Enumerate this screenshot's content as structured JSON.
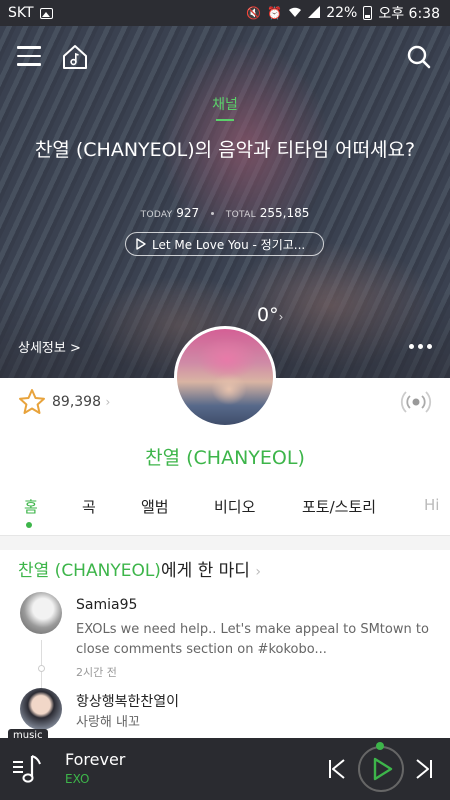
{
  "status_bar": {
    "carrier": "SKT",
    "battery": "22%",
    "time": "오후 6:38"
  },
  "hero": {
    "channel_label": "채널",
    "title": "찬열 (CHANYEOL)의 음악과 티타임 어떠세요?",
    "today_label": "TODAY",
    "today_value": "927",
    "total_label": "TOTAL",
    "total_value": "255,185",
    "song_pill": "Let Me Love You - 정기고...",
    "temperature": "0°",
    "details_link": "상세정보 >"
  },
  "profile": {
    "favorites": "89,398",
    "artist_name": "찬열 (CHANYEOL)"
  },
  "tabs": [
    {
      "label": "홈",
      "active": true
    },
    {
      "label": "곡",
      "active": false
    },
    {
      "label": "앨범",
      "active": false
    },
    {
      "label": "비디오",
      "active": false
    },
    {
      "label": "포토/스토리",
      "active": false
    },
    {
      "label": "Hi",
      "active": false
    }
  ],
  "comments_section": {
    "title_artist": "찬열 (CHANYEOL)",
    "title_rest": "에게 한 마디",
    "comments": [
      {
        "user": "Samia95",
        "text": "EXOLs we need help.. Let's make appeal to SMtown to close comments section on #kokobo...",
        "time": "2시간 전"
      },
      {
        "user": "항상행복한찬열이",
        "text": "사랑해 내꼬"
      }
    ]
  },
  "player": {
    "badge": "music",
    "track_title": "Forever",
    "track_artist": "EXO"
  },
  "colors": {
    "accent_green": "#3db54a",
    "hero_green": "#5bd06a",
    "player_bg": "#2a2b30"
  },
  "icons": [
    "menu-icon",
    "home-icon",
    "search-icon",
    "star-icon",
    "radio-icon",
    "playlist-icon",
    "previous-icon",
    "play-icon",
    "next-icon"
  ]
}
